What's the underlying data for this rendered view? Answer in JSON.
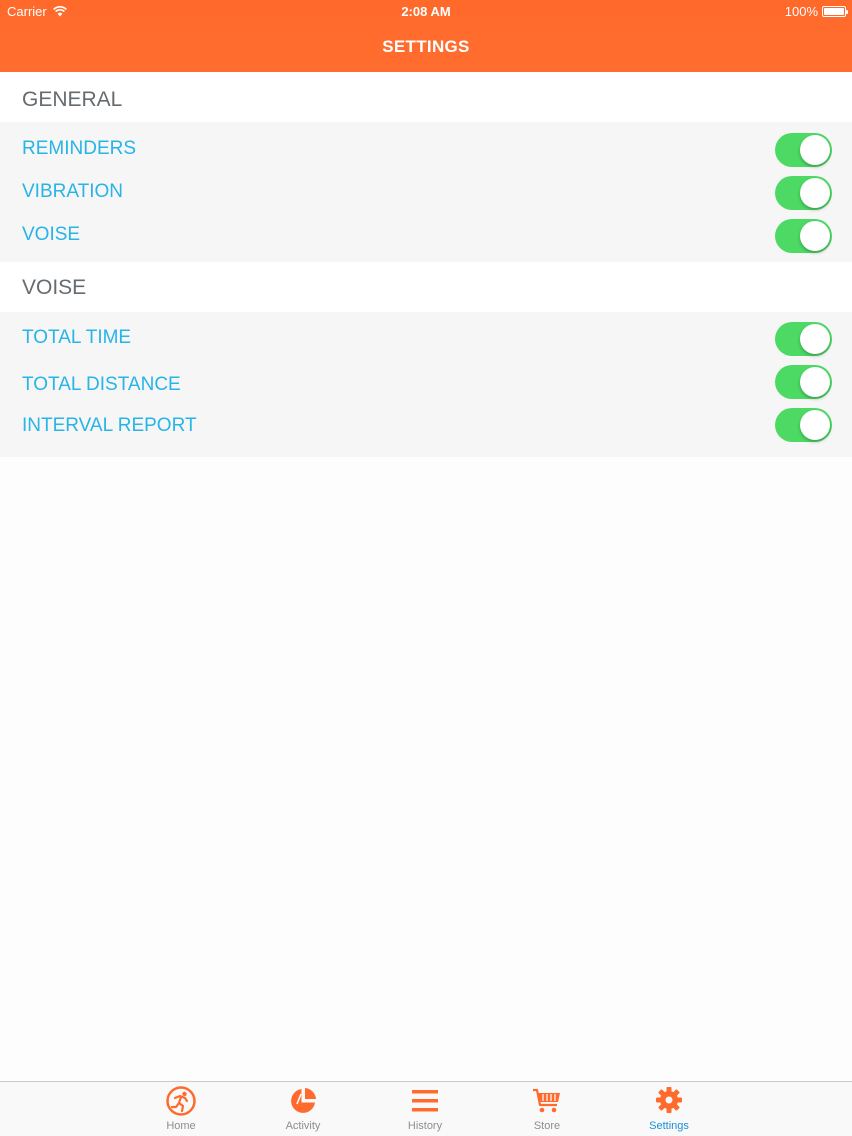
{
  "status_bar": {
    "carrier": "Carrier",
    "time": "2:08 AM",
    "battery": "100%"
  },
  "nav": {
    "title": "SETTINGS"
  },
  "sections": [
    {
      "title": "GENERAL",
      "rows": [
        {
          "label": "REMINDERS",
          "on": true
        },
        {
          "label": "VIBRATION",
          "on": true
        },
        {
          "label": "VOISE",
          "on": true
        }
      ]
    },
    {
      "title": "VOISE",
      "rows": [
        {
          "label": "TOTAL TIME",
          "on": true
        },
        {
          "label": "TOTAL DISTANCE",
          "on": true
        },
        {
          "label": "INTERVAL REPORT",
          "on": true
        }
      ]
    }
  ],
  "tab_bar": {
    "tabs": [
      {
        "label": "Home",
        "icon": "runner-icon",
        "active": false
      },
      {
        "label": "Activity",
        "icon": "pie-chart-icon",
        "active": false
      },
      {
        "label": "History",
        "icon": "list-icon",
        "active": false
      },
      {
        "label": "Store",
        "icon": "cart-icon",
        "active": false
      },
      {
        "label": "Settings",
        "icon": "gear-icon",
        "active": true
      }
    ]
  },
  "colors": {
    "brand_orange": "#ff6b2d",
    "toggle_on": "#4cd964",
    "label_blue": "#27b4e7",
    "tab_active": "#1a8fd8"
  }
}
